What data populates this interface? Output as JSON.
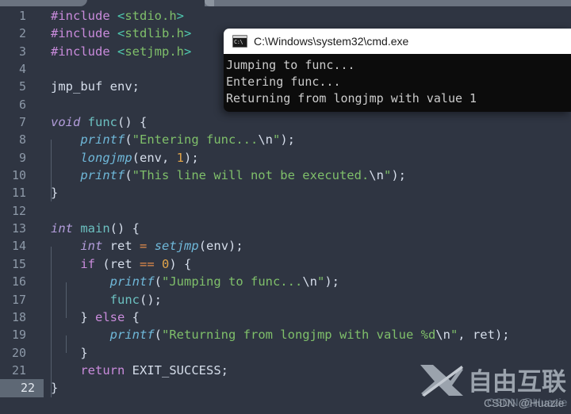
{
  "editor": {
    "theme_bg": "#2f3542",
    "gutter_color": "#8d99a8",
    "current_line": 22,
    "lines": [
      {
        "n": "1",
        "tokens": [
          {
            "c": "t-pp",
            "v": "#include"
          },
          {
            "c": "t-plain",
            "v": " "
          },
          {
            "c": "t-angle",
            "v": "<"
          },
          {
            "c": "t-header",
            "v": "stdio.h"
          },
          {
            "c": "t-angle",
            "v": ">"
          }
        ]
      },
      {
        "n": "2",
        "tokens": [
          {
            "c": "t-pp",
            "v": "#include"
          },
          {
            "c": "t-plain",
            "v": " "
          },
          {
            "c": "t-angle",
            "v": "<"
          },
          {
            "c": "t-header",
            "v": "stdlib.h"
          },
          {
            "c": "t-angle",
            "v": ">"
          }
        ]
      },
      {
        "n": "3",
        "tokens": [
          {
            "c": "t-pp",
            "v": "#include"
          },
          {
            "c": "t-plain",
            "v": " "
          },
          {
            "c": "t-angle",
            "v": "<"
          },
          {
            "c": "t-header",
            "v": "setjmp.h"
          },
          {
            "c": "t-angle",
            "v": ">"
          }
        ]
      },
      {
        "n": "4",
        "tokens": []
      },
      {
        "n": "5",
        "tokens": [
          {
            "c": "t-plain",
            "v": "jmp_buf env"
          },
          {
            "c": "t-punct",
            "v": ";"
          }
        ]
      },
      {
        "n": "6",
        "tokens": []
      },
      {
        "n": "7",
        "tokens": [
          {
            "c": "t-type",
            "v": "void"
          },
          {
            "c": "t-plain",
            "v": " "
          },
          {
            "c": "t-fndef",
            "v": "func"
          },
          {
            "c": "t-punct",
            "v": "() {"
          }
        ]
      },
      {
        "n": "8",
        "tokens": [
          {
            "c": "t-plain",
            "v": "    "
          },
          {
            "c": "t-fn",
            "v": "printf"
          },
          {
            "c": "t-punct",
            "v": "("
          },
          {
            "c": "t-str",
            "v": "\"Entering func..."
          },
          {
            "c": "t-esc",
            "v": "\\n"
          },
          {
            "c": "t-str",
            "v": "\""
          },
          {
            "c": "t-punct",
            "v": ");"
          }
        ]
      },
      {
        "n": "9",
        "tokens": [
          {
            "c": "t-plain",
            "v": "    "
          },
          {
            "c": "t-fn",
            "v": "longjmp"
          },
          {
            "c": "t-punct",
            "v": "("
          },
          {
            "c": "t-var",
            "v": "env"
          },
          {
            "c": "t-punct",
            "v": ", "
          },
          {
            "c": "t-num",
            "v": "1"
          },
          {
            "c": "t-punct",
            "v": ");"
          }
        ]
      },
      {
        "n": "10",
        "tokens": [
          {
            "c": "t-plain",
            "v": "    "
          },
          {
            "c": "t-fn",
            "v": "printf"
          },
          {
            "c": "t-punct",
            "v": "("
          },
          {
            "c": "t-str",
            "v": "\"This line will not be executed."
          },
          {
            "c": "t-esc",
            "v": "\\n"
          },
          {
            "c": "t-str",
            "v": "\""
          },
          {
            "c": "t-punct",
            "v": ");"
          }
        ]
      },
      {
        "n": "11",
        "tokens": [
          {
            "c": "t-punct",
            "v": "}"
          }
        ]
      },
      {
        "n": "12",
        "tokens": []
      },
      {
        "n": "13",
        "tokens": [
          {
            "c": "t-type",
            "v": "int"
          },
          {
            "c": "t-plain",
            "v": " "
          },
          {
            "c": "t-fndef",
            "v": "main"
          },
          {
            "c": "t-punct",
            "v": "() {"
          }
        ]
      },
      {
        "n": "14",
        "tokens": [
          {
            "c": "t-plain",
            "v": "    "
          },
          {
            "c": "t-type",
            "v": "int"
          },
          {
            "c": "t-plain",
            "v": " "
          },
          {
            "c": "t-var",
            "v": "ret"
          },
          {
            "c": "t-plain",
            "v": " "
          },
          {
            "c": "t-op",
            "v": "="
          },
          {
            "c": "t-plain",
            "v": " "
          },
          {
            "c": "t-fn",
            "v": "setjmp"
          },
          {
            "c": "t-punct",
            "v": "("
          },
          {
            "c": "t-var",
            "v": "env"
          },
          {
            "c": "t-punct",
            "v": ");"
          }
        ]
      },
      {
        "n": "15",
        "tokens": [
          {
            "c": "t-plain",
            "v": "    "
          },
          {
            "c": "t-kw",
            "v": "if"
          },
          {
            "c": "t-plain",
            "v": " "
          },
          {
            "c": "t-punct",
            "v": "("
          },
          {
            "c": "t-var",
            "v": "ret"
          },
          {
            "c": "t-plain",
            "v": " "
          },
          {
            "c": "t-op",
            "v": "=="
          },
          {
            "c": "t-plain",
            "v": " "
          },
          {
            "c": "t-num",
            "v": "0"
          },
          {
            "c": "t-punct",
            "v": ") {"
          }
        ]
      },
      {
        "n": "16",
        "tokens": [
          {
            "c": "t-plain",
            "v": "        "
          },
          {
            "c": "t-fn",
            "v": "printf"
          },
          {
            "c": "t-punct",
            "v": "("
          },
          {
            "c": "t-str",
            "v": "\"Jumping to func..."
          },
          {
            "c": "t-esc",
            "v": "\\n"
          },
          {
            "c": "t-str",
            "v": "\""
          },
          {
            "c": "t-punct",
            "v": ");"
          }
        ]
      },
      {
        "n": "17",
        "tokens": [
          {
            "c": "t-plain",
            "v": "        "
          },
          {
            "c": "t-fndef",
            "v": "func"
          },
          {
            "c": "t-punct",
            "v": "();"
          }
        ]
      },
      {
        "n": "18",
        "tokens": [
          {
            "c": "t-punct",
            "v": "    } "
          },
          {
            "c": "t-kw",
            "v": "else"
          },
          {
            "c": "t-punct",
            "v": " {"
          }
        ]
      },
      {
        "n": "19",
        "tokens": [
          {
            "c": "t-plain",
            "v": "        "
          },
          {
            "c": "t-fn",
            "v": "printf"
          },
          {
            "c": "t-punct",
            "v": "("
          },
          {
            "c": "t-str",
            "v": "\"Returning from longjmp with value %d"
          },
          {
            "c": "t-esc",
            "v": "\\n"
          },
          {
            "c": "t-str",
            "v": "\""
          },
          {
            "c": "t-punct",
            "v": ", "
          },
          {
            "c": "t-var",
            "v": "ret"
          },
          {
            "c": "t-punct",
            "v": ");"
          }
        ]
      },
      {
        "n": "20",
        "tokens": [
          {
            "c": "t-punct",
            "v": "    }"
          }
        ]
      },
      {
        "n": "21",
        "tokens": [
          {
            "c": "t-plain",
            "v": "    "
          },
          {
            "c": "t-kw",
            "v": "return"
          },
          {
            "c": "t-plain",
            "v": " "
          },
          {
            "c": "t-const",
            "v": "EXIT_SUCCESS"
          },
          {
            "c": "t-punct",
            "v": ";"
          }
        ]
      },
      {
        "n": "22",
        "tokens": [
          {
            "c": "t-punct",
            "v": "}"
          }
        ]
      }
    ]
  },
  "cmd_window": {
    "title": "C:\\Windows\\system32\\cmd.exe",
    "icon_label": "C:\\",
    "console_lines": [
      "Jumping to func...",
      "Entering func...",
      "Returning from longjmp with value 1"
    ]
  },
  "watermark": {
    "brand_cn": "自由互联",
    "credit": "CSDN @Huazie"
  }
}
